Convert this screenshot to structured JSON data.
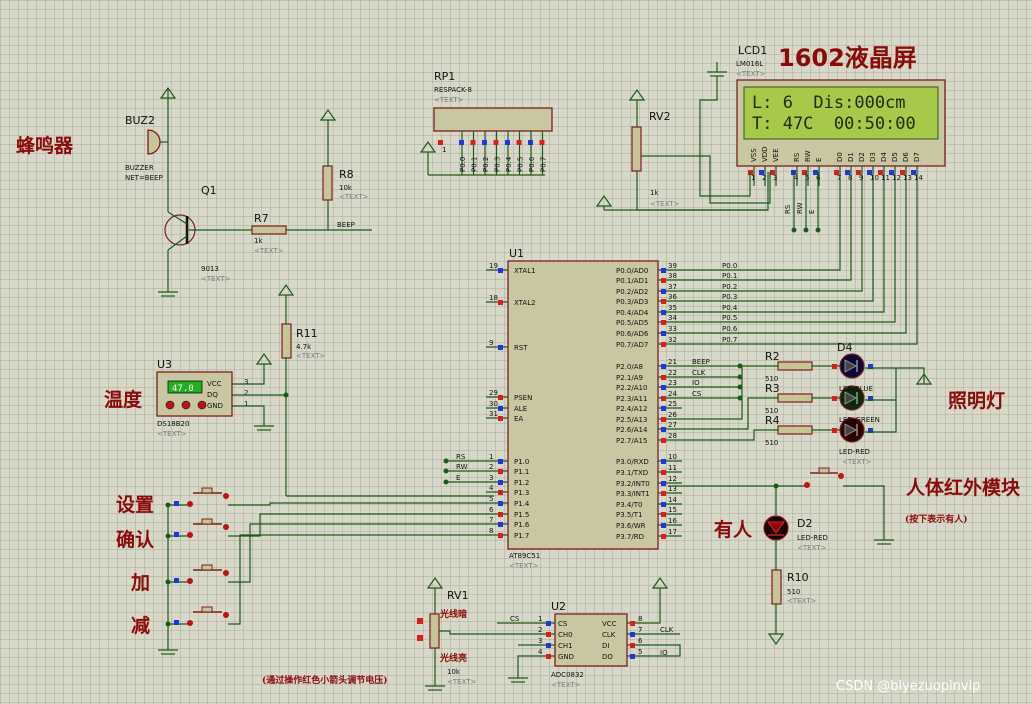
{
  "title": "1602液晶屏",
  "labels_cn": {
    "buzzer": "蜂鸣器",
    "temperature": "温度",
    "set": "设置",
    "confirm": "确认",
    "add": "加",
    "sub": "减",
    "lighting": "照明灯",
    "pir": "人体红外模块",
    "pir_note": "(按下表示有人)",
    "someone": "有人",
    "light_dark": "光线暗",
    "light_bright": "光线亮",
    "rv1_note": "(通过操作红色小箭头调节电压)"
  },
  "lcd": {
    "ref": "LCD1",
    "part": "LM016L",
    "text_tag": "<TEXT>",
    "line1": "L: 6  Dis:000cm",
    "line2": "T: 47C  00:50:00",
    "pins": [
      "VSS",
      "VDD",
      "VEE",
      "RS",
      "RW",
      "E",
      "D0",
      "D1",
      "D2",
      "D3",
      "D4",
      "D5",
      "D6",
      "D7"
    ],
    "pin_nums": [
      "1",
      "2",
      "3",
      "4",
      "5",
      "6",
      "7",
      "8",
      "9",
      "10",
      "11",
      "12",
      "13",
      "14"
    ]
  },
  "rp1": {
    "ref": "RP1",
    "part": "RESPACK-8",
    "text_tag": "<TEXT>",
    "pins": [
      "P0.0",
      "P0.1",
      "P0.2",
      "P0.3",
      "P0.4",
      "P0.5",
      "P0.6",
      "P0.7"
    ],
    "pin1": "1"
  },
  "buz2": {
    "ref": "BUZ2",
    "part": "BUZZER",
    "net": "NET=BEEP"
  },
  "q1": {
    "ref": "Q1",
    "part": "9013",
    "text_tag": "<TEXT>"
  },
  "r7": {
    "ref": "R7",
    "value": "1k",
    "text_tag": "<TEXT>"
  },
  "r8": {
    "ref": "R8",
    "value": "10k",
    "text_tag": "<TEXT>"
  },
  "beep_net": "BEEP",
  "rv2": {
    "ref": "RV2",
    "value": "1k",
    "text_tag": "<TEXT>"
  },
  "r11": {
    "ref": "R11",
    "value": "4.7k",
    "text_tag": "<TEXT>"
  },
  "u3": {
    "ref": "U3",
    "part": "DS18B20",
    "text_tag": "<TEXT>",
    "display": "47.0",
    "pins": [
      "VCC",
      "DQ",
      "GND"
    ],
    "pin_nums": [
      "3",
      "2",
      "1"
    ]
  },
  "u1": {
    "ref": "U1",
    "part": "AT89C51",
    "text_tag": "<TEXT>",
    "left_pins": [
      {
        "num": "19",
        "name": "XTAL1"
      },
      {
        "num": "18",
        "name": "XTAL2"
      },
      {
        "num": "9",
        "name": "RST"
      },
      {
        "num": "29",
        "name": "PSEN"
      },
      {
        "num": "30",
        "name": "ALE"
      },
      {
        "num": "31",
        "name": "EA"
      },
      {
        "num": "1",
        "name": "P1.0"
      },
      {
        "num": "2",
        "name": "P1.1"
      },
      {
        "num": "3",
        "name": "P1.2"
      },
      {
        "num": "4",
        "name": "P1.3"
      },
      {
        "num": "5",
        "name": "P1.4"
      },
      {
        "num": "6",
        "name": "P1.5"
      },
      {
        "num": "7",
        "name": "P1.6"
      },
      {
        "num": "8",
        "name": "P1.7"
      }
    ],
    "right_pins": [
      {
        "num": "39",
        "name": "P0.0/AD0"
      },
      {
        "num": "38",
        "name": "P0.1/AD1"
      },
      {
        "num": "37",
        "name": "P0.2/AD2"
      },
      {
        "num": "36",
        "name": "P0.3/AD3"
      },
      {
        "num": "35",
        "name": "P0.4/AD4"
      },
      {
        "num": "34",
        "name": "P0.5/AD5"
      },
      {
        "num": "33",
        "name": "P0.6/AD6"
      },
      {
        "num": "32",
        "name": "P0.7/AD7"
      },
      {
        "num": "21",
        "name": "P2.0/A8"
      },
      {
        "num": "22",
        "name": "P2.1/A9"
      },
      {
        "num": "23",
        "name": "P2.2/A10"
      },
      {
        "num": "24",
        "name": "P2.3/A11"
      },
      {
        "num": "25",
        "name": "P2.4/A12"
      },
      {
        "num": "26",
        "name": "P2.5/A13"
      },
      {
        "num": "27",
        "name": "P2.6/A14"
      },
      {
        "num": "28",
        "name": "P2.7/A15"
      },
      {
        "num": "10",
        "name": "P3.0/RXD"
      },
      {
        "num": "11",
        "name": "P3.1/TXD"
      },
      {
        "num": "12",
        "name": "P3.2/INT0"
      },
      {
        "num": "13",
        "name": "P3.3/INT1"
      },
      {
        "num": "14",
        "name": "P3.4/T0"
      },
      {
        "num": "15",
        "name": "P3.5/T1"
      },
      {
        "num": "16",
        "name": "P3.6/WR"
      },
      {
        "num": "17",
        "name": "P3.7/RD"
      }
    ]
  },
  "p0_nets": [
    "P0.0",
    "P0.1",
    "P0.2",
    "P0.3",
    "P0.4",
    "P0.5",
    "P0.6",
    "P0.7"
  ],
  "p2_nets": [
    "BEEP",
    "CLK",
    "IO",
    "CS"
  ],
  "p1_nets": [
    "RS",
    "RW",
    "E"
  ],
  "lcd_ctrl_nets": [
    "RS",
    "RW",
    "E"
  ],
  "r2": {
    "ref": "R2",
    "value": "510"
  },
  "r3": {
    "ref": "R3",
    "value": "510"
  },
  "r4": {
    "ref": "R4",
    "value": "510"
  },
  "d4": {
    "ref": "D4",
    "part": "LED-BLUE"
  },
  "d_green": {
    "part": "LED-GREEN"
  },
  "d_red": {
    "part": "LED-RED",
    "text_tag": "<TEXT>"
  },
  "d2": {
    "ref": "D2",
    "part": "LED-RED",
    "text_tag": "<TEXT>"
  },
  "r10": {
    "ref": "R10",
    "value": "510",
    "text_tag": "<TEXT>"
  },
  "rv1": {
    "ref": "RV1",
    "value": "10k",
    "text_tag": "<TEXT>"
  },
  "u2": {
    "ref": "U2",
    "part": "ADC0832",
    "text_tag": "<TEXT>",
    "left_pins": [
      {
        "num": "1",
        "name": "CS"
      },
      {
        "num": "2",
        "name": "CH0"
      },
      {
        "num": "3",
        "name": "CH1"
      },
      {
        "num": "4",
        "name": "GND"
      }
    ],
    "right_pins": [
      {
        "num": "8",
        "name": "VCC"
      },
      {
        "num": "7",
        "name": "CLK"
      },
      {
        "num": "6",
        "name": "DI"
      },
      {
        "num": "5",
        "name": "DO"
      }
    ]
  },
  "u2_nets": {
    "cs": "CS",
    "clk": "CLK",
    "io": "IO"
  },
  "watermark": "CSDN @biyezuopinvip"
}
